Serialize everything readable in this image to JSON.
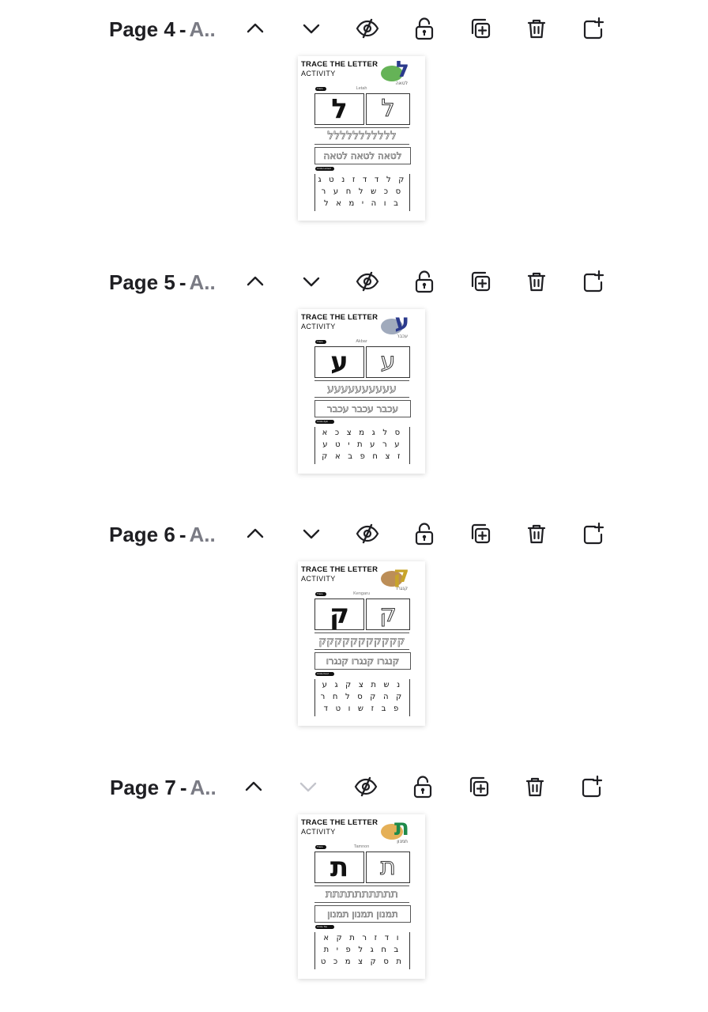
{
  "pages": [
    {
      "num": "Page 4",
      "sep": "-",
      "name": "A..",
      "down_enabled": true,
      "thumbnail": {
        "title": "TRACE THE LETTER",
        "subtitle": "ACTIVITY",
        "letter": "ל",
        "letter_color": "#2b3a8c",
        "animal_color": "#4aa63a",
        "hebrew_word": "לטאה",
        "caption": "Letah",
        "trace_label": "Trace",
        "circle_label": "Circle Lamed",
        "trace_row": "ללללללללללל",
        "word_row": "לטאה לטאה לטאה",
        "grid_rows": [
          "ק ל ד ד ז נ ט ג",
          "ס כ ש ל ח ע ר",
          "ב ו ה י מ א ל"
        ]
      }
    },
    {
      "num": "Page 5",
      "sep": "-",
      "name": "A..",
      "down_enabled": true,
      "thumbnail": {
        "title": "TRACE THE LETTER",
        "subtitle": "ACTIVITY",
        "letter": "ע",
        "letter_color": "#2b3a8c",
        "animal_color": "#8f9bb0",
        "hebrew_word": "עכבר",
        "caption": "Akbar",
        "trace_label": "Trace",
        "circle_label": "Circle Ayin",
        "trace_row": "עעעעעעעעעע",
        "word_row": "עכבר עכבר עכבר",
        "grid_rows": [
          "ס ל ג מ צ כ א",
          "ע ר ע ת י ט ע",
          "ז צ ח פ ב א ק"
        ]
      }
    },
    {
      "num": "Page 6",
      "sep": "-",
      "name": "A..",
      "down_enabled": true,
      "thumbnail": {
        "title": "TRACE THE LETTER",
        "subtitle": "ACTIVITY",
        "letter": "ק",
        "letter_color": "#c8a42a",
        "animal_color": "#b07a3a",
        "hebrew_word": "קנגרו",
        "caption": "Kengaru",
        "trace_label": "Trace",
        "circle_label": "Circle Kouf",
        "trace_row": "קקקקקקקקקקק",
        "word_row": "קנגרו קנגרו קנגרו",
        "grid_rows": [
          "נ ש ת צ ק ג ע",
          "ק ה ק ס ל ח ר",
          "פ ב ז ש ו ט ד"
        ]
      }
    },
    {
      "num": "Page 7",
      "sep": "-",
      "name": "A..",
      "down_enabled": false,
      "thumbnail": {
        "title": "TRACE THE LETTER",
        "subtitle": "ACTIVITY",
        "letter": "ת",
        "letter_color": "#1f8a4a",
        "animal_color": "#e0a23a",
        "hebrew_word": "תמנון",
        "caption": "Tamnon",
        "trace_label": "Trace",
        "circle_label": "Circle Tav",
        "trace_row": "תתתתתתתתתת",
        "word_row": "תמנון תמנון תמנון",
        "grid_rows": [
          "ו ד ז ר ת ק א",
          "ב ח ג ל פ י ת",
          "ת ס ק צ מ כ ט"
        ]
      }
    }
  ],
  "icons": {
    "move_up": "chevron-up-icon",
    "move_down": "chevron-down-icon",
    "hide": "eye-slash-icon",
    "lock": "unlock-icon",
    "duplicate": "duplicate-icon",
    "delete": "trash-icon",
    "add": "add-page-icon"
  },
  "colors": {
    "icon": "#1f1f23",
    "icon_disabled": "#c4c5cc",
    "title_name": "#7a7b84"
  }
}
